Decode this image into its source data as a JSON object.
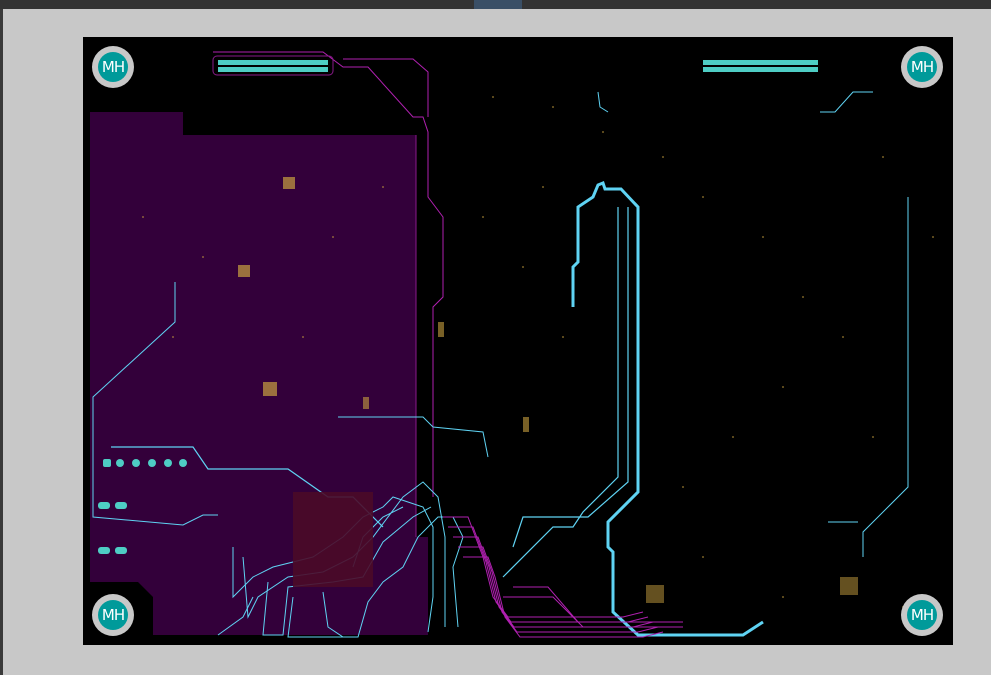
{
  "toolbar": {
    "tab_label": ""
  },
  "board": {
    "mounting_holes": [
      {
        "label": "MH"
      },
      {
        "label": "MH"
      },
      {
        "label": "MH"
      },
      {
        "label": "MH"
      }
    ]
  },
  "colors": {
    "background": "#c8c8c8",
    "board": "#000000",
    "copper_pour": "#33003a",
    "trace_cyan": "#5fd3f3",
    "trace_magenta": "#b020b0",
    "pad_teal": "#4ecdc4",
    "via_gold": "#c8a040",
    "mounting_hole": "#009a9a"
  },
  "icons": [
    "mounting-hole-icon",
    "connector-header-icon"
  ]
}
